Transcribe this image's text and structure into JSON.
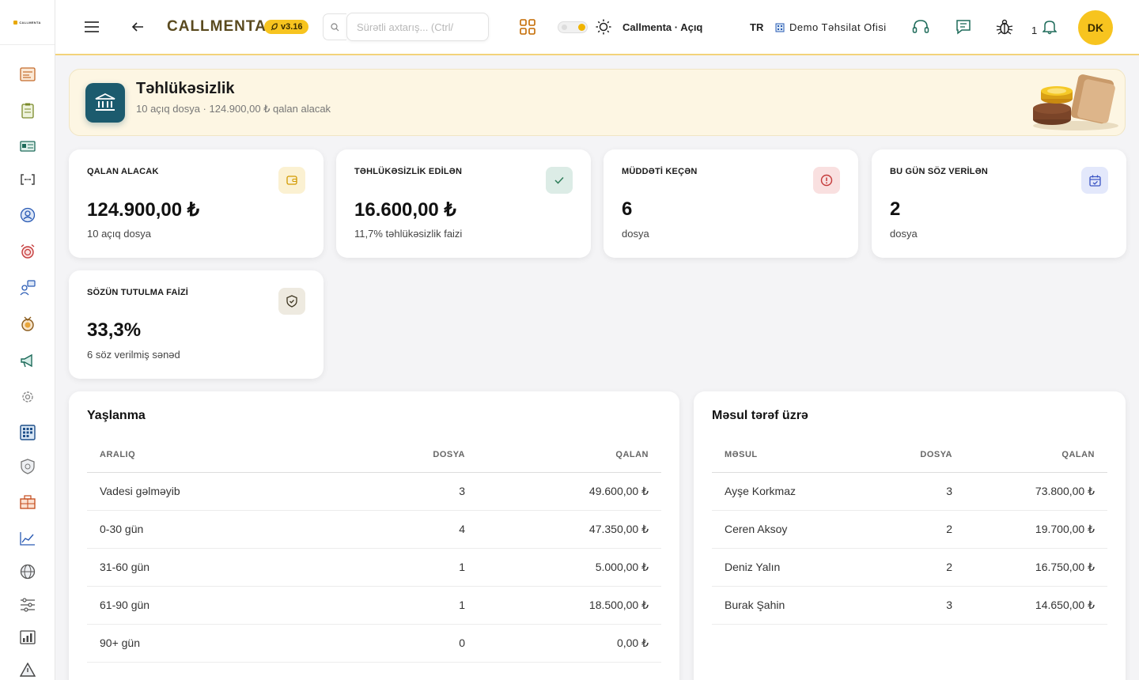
{
  "app": {
    "logo_text": "CALLMENTA",
    "brand": "CALLMENTA",
    "version": "v3.16"
  },
  "topbar": {
    "search_placeholder": "Sürətli axtarış... (Ctrl/",
    "status_text": "Callmenta · Açıq",
    "language": "TR",
    "office_name": "Demo Təhsilat Ofisi",
    "notification_count": "1",
    "avatar_initials": "DK"
  },
  "header": {
    "title": "Təhlükəsizlik",
    "subtitle": "10 açıq dosya · 124.900,00 ₺ qalan alacak"
  },
  "kpis": [
    {
      "label": "QALAN ALACAK",
      "value": "124.900,00 ₺",
      "sub": "10 açıq dosya",
      "icon": "wallet-icon",
      "color": "#fbf1d2",
      "stroke": "#d29a00"
    },
    {
      "label": "TƏHLÜKƏSİZLİK EDİLƏN",
      "value": "16.600,00 ₺",
      "sub": "11,7% təhlükəsizlik faizi",
      "icon": "check-icon",
      "color": "#dcece6",
      "stroke": "#2e7d5a"
    },
    {
      "label": "MÜDDƏTİ KEÇƏN",
      "value": "6",
      "sub": "dosya",
      "icon": "alert-circle-icon",
      "color": "#f9e0e0",
      "stroke": "#c43a3a"
    },
    {
      "label": "BU GÜN SÖZ VERİLƏN",
      "value": "2",
      "sub": "dosya",
      "icon": "calendar-check-icon",
      "color": "#e3e8fb",
      "stroke": "#3b54c4"
    },
    {
      "label": "SÖZÜN TUTULMA FAİZİ",
      "value": "33,3%",
      "sub": "6 söz verilmiş sənəd",
      "icon": "shield-check-icon",
      "color": "#eeeae0",
      "stroke": "#6b5d3a"
    }
  ],
  "aging": {
    "title": "Yaşlanma",
    "columns": [
      "ARALIQ",
      "DOSYA",
      "QALAN"
    ],
    "rows": [
      [
        "Vadesi gəlməyib",
        "3",
        "49.600,00 ₺"
      ],
      [
        "0-30 gün",
        "4",
        "47.350,00 ₺"
      ],
      [
        "31-60 gün",
        "1",
        "5.000,00 ₺"
      ],
      [
        "61-90 gün",
        "1",
        "18.500,00 ₺"
      ],
      [
        "90+ gün",
        "0",
        "0,00 ₺"
      ]
    ]
  },
  "responsible": {
    "title": "Məsul tərəf üzrə",
    "columns": [
      "MƏSUL",
      "DOSYA",
      "QALAN"
    ],
    "rows": [
      [
        "Ayşe Korkmaz",
        "3",
        "73.800,00 ₺"
      ],
      [
        "Ceren Aksoy",
        "2",
        "19.700,00 ₺"
      ],
      [
        "Deniz Yalın",
        "2",
        "16.750,00 ₺"
      ],
      [
        "Burak Şahin",
        "3",
        "14.650,00 ₺"
      ]
    ]
  }
}
